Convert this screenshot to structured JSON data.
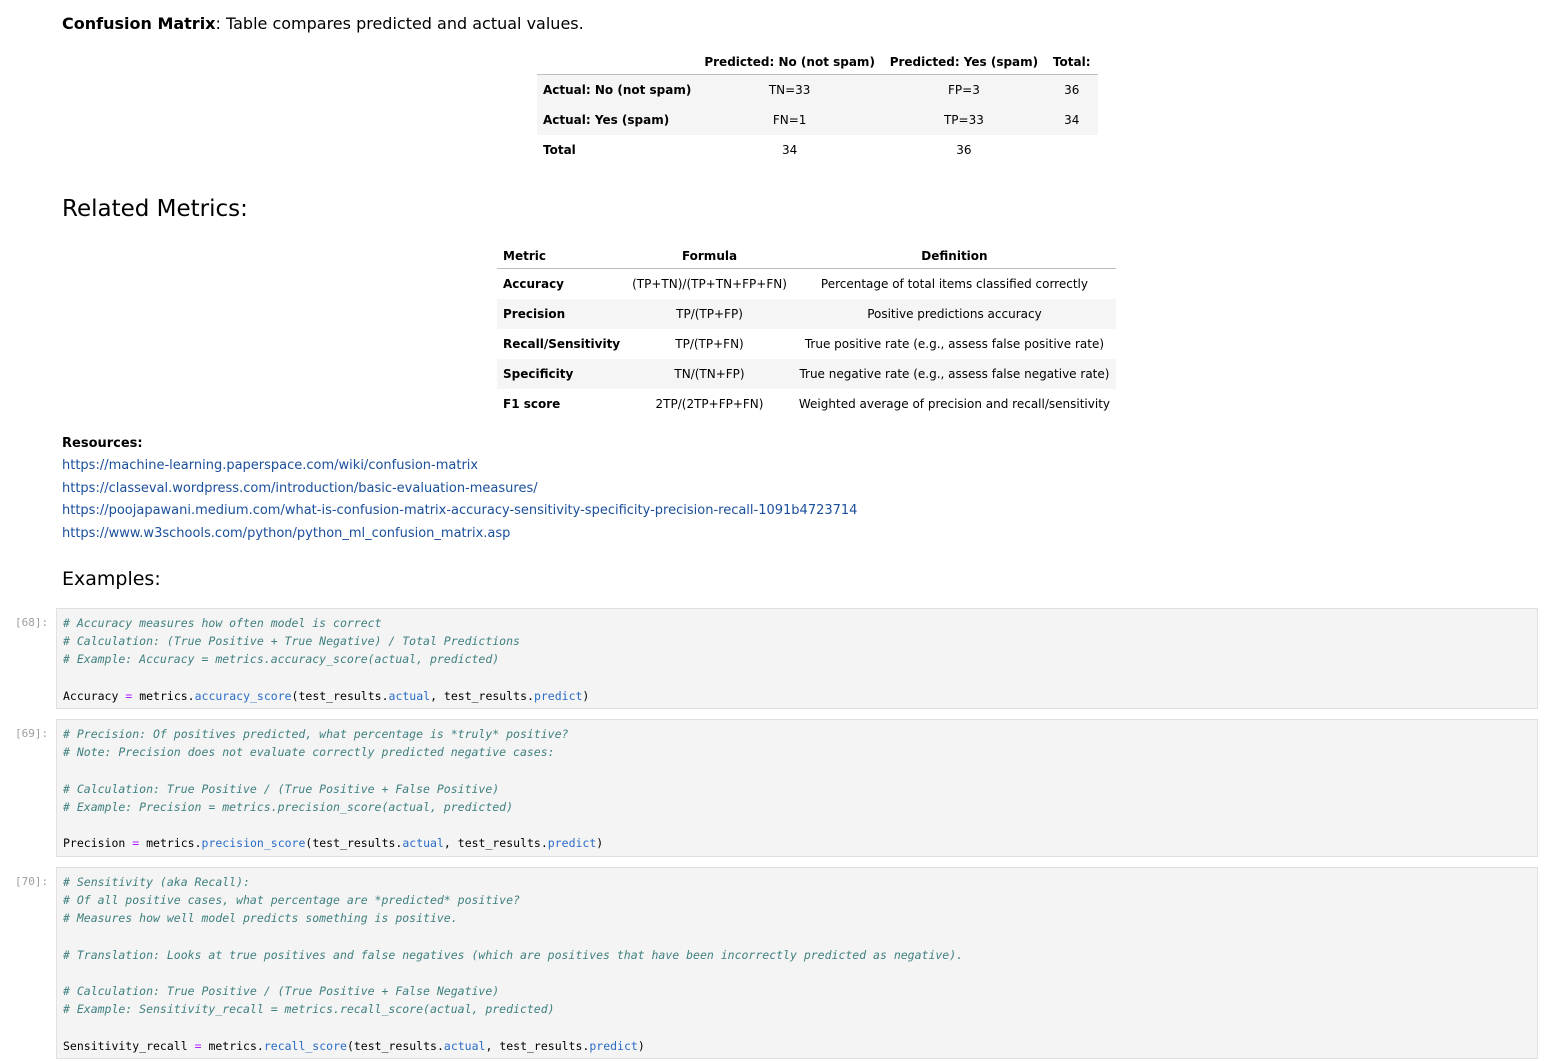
{
  "intro": {
    "bold": "Confusion Matrix",
    "text": ": Table compares predicted and actual values."
  },
  "confusion_matrix": {
    "headers": [
      "",
      "Predicted: No (not spam)",
      "Predicted: Yes (spam)",
      "Total:"
    ],
    "rows": [
      [
        "Actual: No (not spam)",
        "TN=33",
        "FP=3",
        "36"
      ],
      [
        "Actual: Yes (spam)",
        "FN=1",
        "TP=33",
        "34"
      ],
      [
        "Total",
        "34",
        "36",
        ""
      ]
    ]
  },
  "related_metrics": {
    "title": "Related Metrics:",
    "headers": [
      "Metric",
      "Formula",
      "Definition"
    ],
    "rows": [
      [
        "Accuracy",
        "(TP+TN)/(TP+TN+FP+FN)",
        "Percentage of total items classified correctly"
      ],
      [
        "Precision",
        "TP/(TP+FP)",
        "Positive predictions accuracy"
      ],
      [
        "Recall/Sensitivity",
        "TP/(TP+FN)",
        "True positive rate (e.g., assess false positive rate)"
      ],
      [
        "Specificity",
        "TN/(TN+FP)",
        "True negative rate (e.g., assess false negative rate)"
      ],
      [
        "F1 score",
        "2TP/(2TP+FP+FN)",
        "Weighted average of precision and recall/sensitivity"
      ]
    ]
  },
  "resources": {
    "title": "Resources:",
    "links": [
      "https://machine-learning.paperspace.com/wiki/confusion-matrix",
      "https://classeval.wordpress.com/introduction/basic-evaluation-measures/",
      "https://poojapawani.medium.com/what-is-confusion-matrix-accuracy-sensitivity-specificity-precision-recall-1091b4723714",
      "https://www.w3schools.com/python/python_ml_confusion_matrix.asp"
    ]
  },
  "examples_title": "Examples:",
  "cells": [
    {
      "prompt": "[68]:",
      "lines": [
        {
          "t": "c",
          "s": "# Accuracy measures how often model is correct"
        },
        {
          "t": "c",
          "s": "# Calculation: (True Positive + True Negative) / Total Predictions"
        },
        {
          "t": "c",
          "s": "# Example: Accuracy = metrics.accuracy_score(actual, predicted)"
        },
        {
          "t": "b",
          "s": ""
        },
        {
          "t": "x",
          "var": "Accuracy",
          "obj": "metrics",
          "fn": "accuracy_score",
          "a1": "test_results",
          "a1b": "actual",
          "a2": "test_results",
          "a2b": "predict"
        }
      ]
    },
    {
      "prompt": "[69]:",
      "lines": [
        {
          "t": "c",
          "s": "# Precision: Of positives predicted, what percentage is *truly* positive?"
        },
        {
          "t": "c",
          "s": "# Note: Precision does not evaluate correctly predicted negative cases:"
        },
        {
          "t": "b",
          "s": ""
        },
        {
          "t": "c",
          "s": "# Calculation: True Positive / (True Positive + False Positive)"
        },
        {
          "t": "c",
          "s": "# Example: Precision = metrics.precision_score(actual, predicted)"
        },
        {
          "t": "b",
          "s": ""
        },
        {
          "t": "x",
          "var": "Precision",
          "obj": "metrics",
          "fn": "precision_score",
          "a1": "test_results",
          "a1b": "actual",
          "a2": "test_results",
          "a2b": "predict"
        }
      ]
    },
    {
      "prompt": "[70]:",
      "lines": [
        {
          "t": "c",
          "s": "# Sensitivity (aka Recall):"
        },
        {
          "t": "c",
          "s": "# Of all positive cases, what percentage are *predicted* positive?"
        },
        {
          "t": "c",
          "s": "# Measures how well model predicts something is positive."
        },
        {
          "t": "b",
          "s": ""
        },
        {
          "t": "c",
          "s": "# Translation: Looks at true positives and false negatives (which are positives that have been incorrectly predicted as negative)."
        },
        {
          "t": "b",
          "s": ""
        },
        {
          "t": "c",
          "s": "# Calculation: True Positive / (True Positive + False Negative)"
        },
        {
          "t": "c",
          "s": "# Example: Sensitivity_recall = metrics.recall_score(actual, predicted)"
        },
        {
          "t": "b",
          "s": ""
        },
        {
          "t": "x",
          "var": "Sensitivity_recall",
          "obj": "metrics",
          "fn": "recall_score",
          "a1": "test_results",
          "a1b": "actual",
          "a2": "test_results",
          "a2b": "predict"
        }
      ]
    }
  ],
  "colors": {
    "link": "#1a4f9c",
    "comment": "#408080",
    "attr": "#2a6cc8",
    "operator": "#aa22ff",
    "code_bg": "#f4f4f4"
  }
}
